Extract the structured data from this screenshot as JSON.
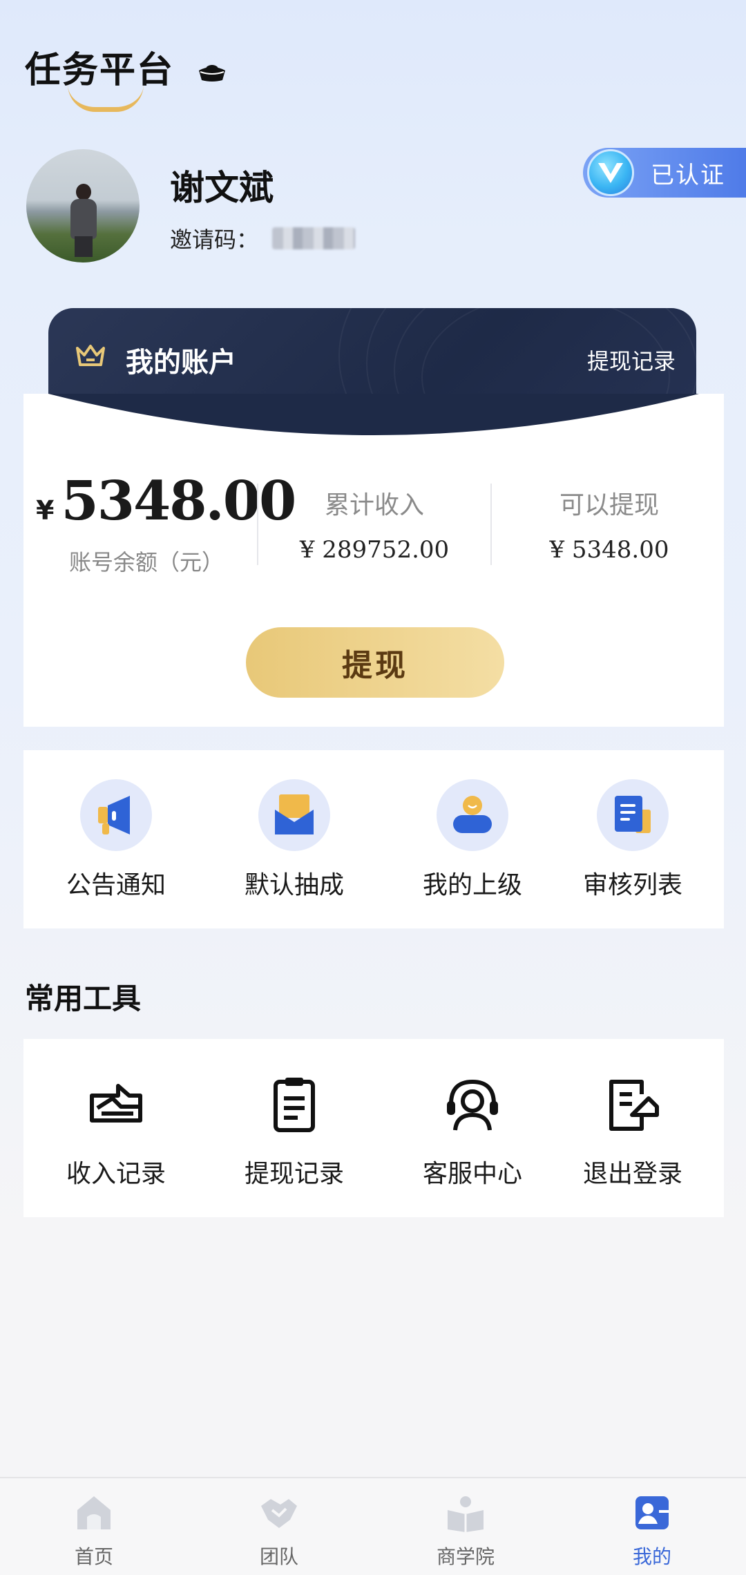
{
  "app": {
    "title": "任务平台"
  },
  "profile": {
    "name": "谢文斌",
    "invite_label": "邀请码：",
    "verified_label": "已认证"
  },
  "account": {
    "title": "我的账户",
    "withdraw_record_link": "提现记录",
    "balance_currency": "¥",
    "balance": "5348.00",
    "balance_label": "账号余额（元）",
    "total_income_label": "累计收入",
    "total_income": "¥ 289752.00",
    "withdrawable_label": "可以提现",
    "withdrawable": "¥ 5348.00",
    "withdraw_button": "提现"
  },
  "quick_actions": [
    {
      "label": "公告通知",
      "icon": "megaphone-icon"
    },
    {
      "label": "默认抽成",
      "icon": "envelope-icon"
    },
    {
      "label": "我的上级",
      "icon": "person-icon"
    },
    {
      "label": "审核列表",
      "icon": "document-icon"
    }
  ],
  "tools": {
    "title": "常用工具",
    "items": [
      {
        "label": "收入记录",
        "icon": "income-record-icon"
      },
      {
        "label": "提现记录",
        "icon": "clipboard-icon"
      },
      {
        "label": "客服中心",
        "icon": "headset-icon"
      },
      {
        "label": "退出登录",
        "icon": "logout-icon"
      }
    ]
  },
  "nav": {
    "items": [
      {
        "label": "首页",
        "icon": "home-icon"
      },
      {
        "label": "团队",
        "icon": "handshake-icon"
      },
      {
        "label": "商学院",
        "icon": "book-icon"
      },
      {
        "label": "我的",
        "icon": "profile-icon"
      }
    ],
    "active_index": 3
  },
  "colors": {
    "accent": "#3a68d8",
    "card_dark": "#1e2a47",
    "gold": "#e8c878"
  }
}
